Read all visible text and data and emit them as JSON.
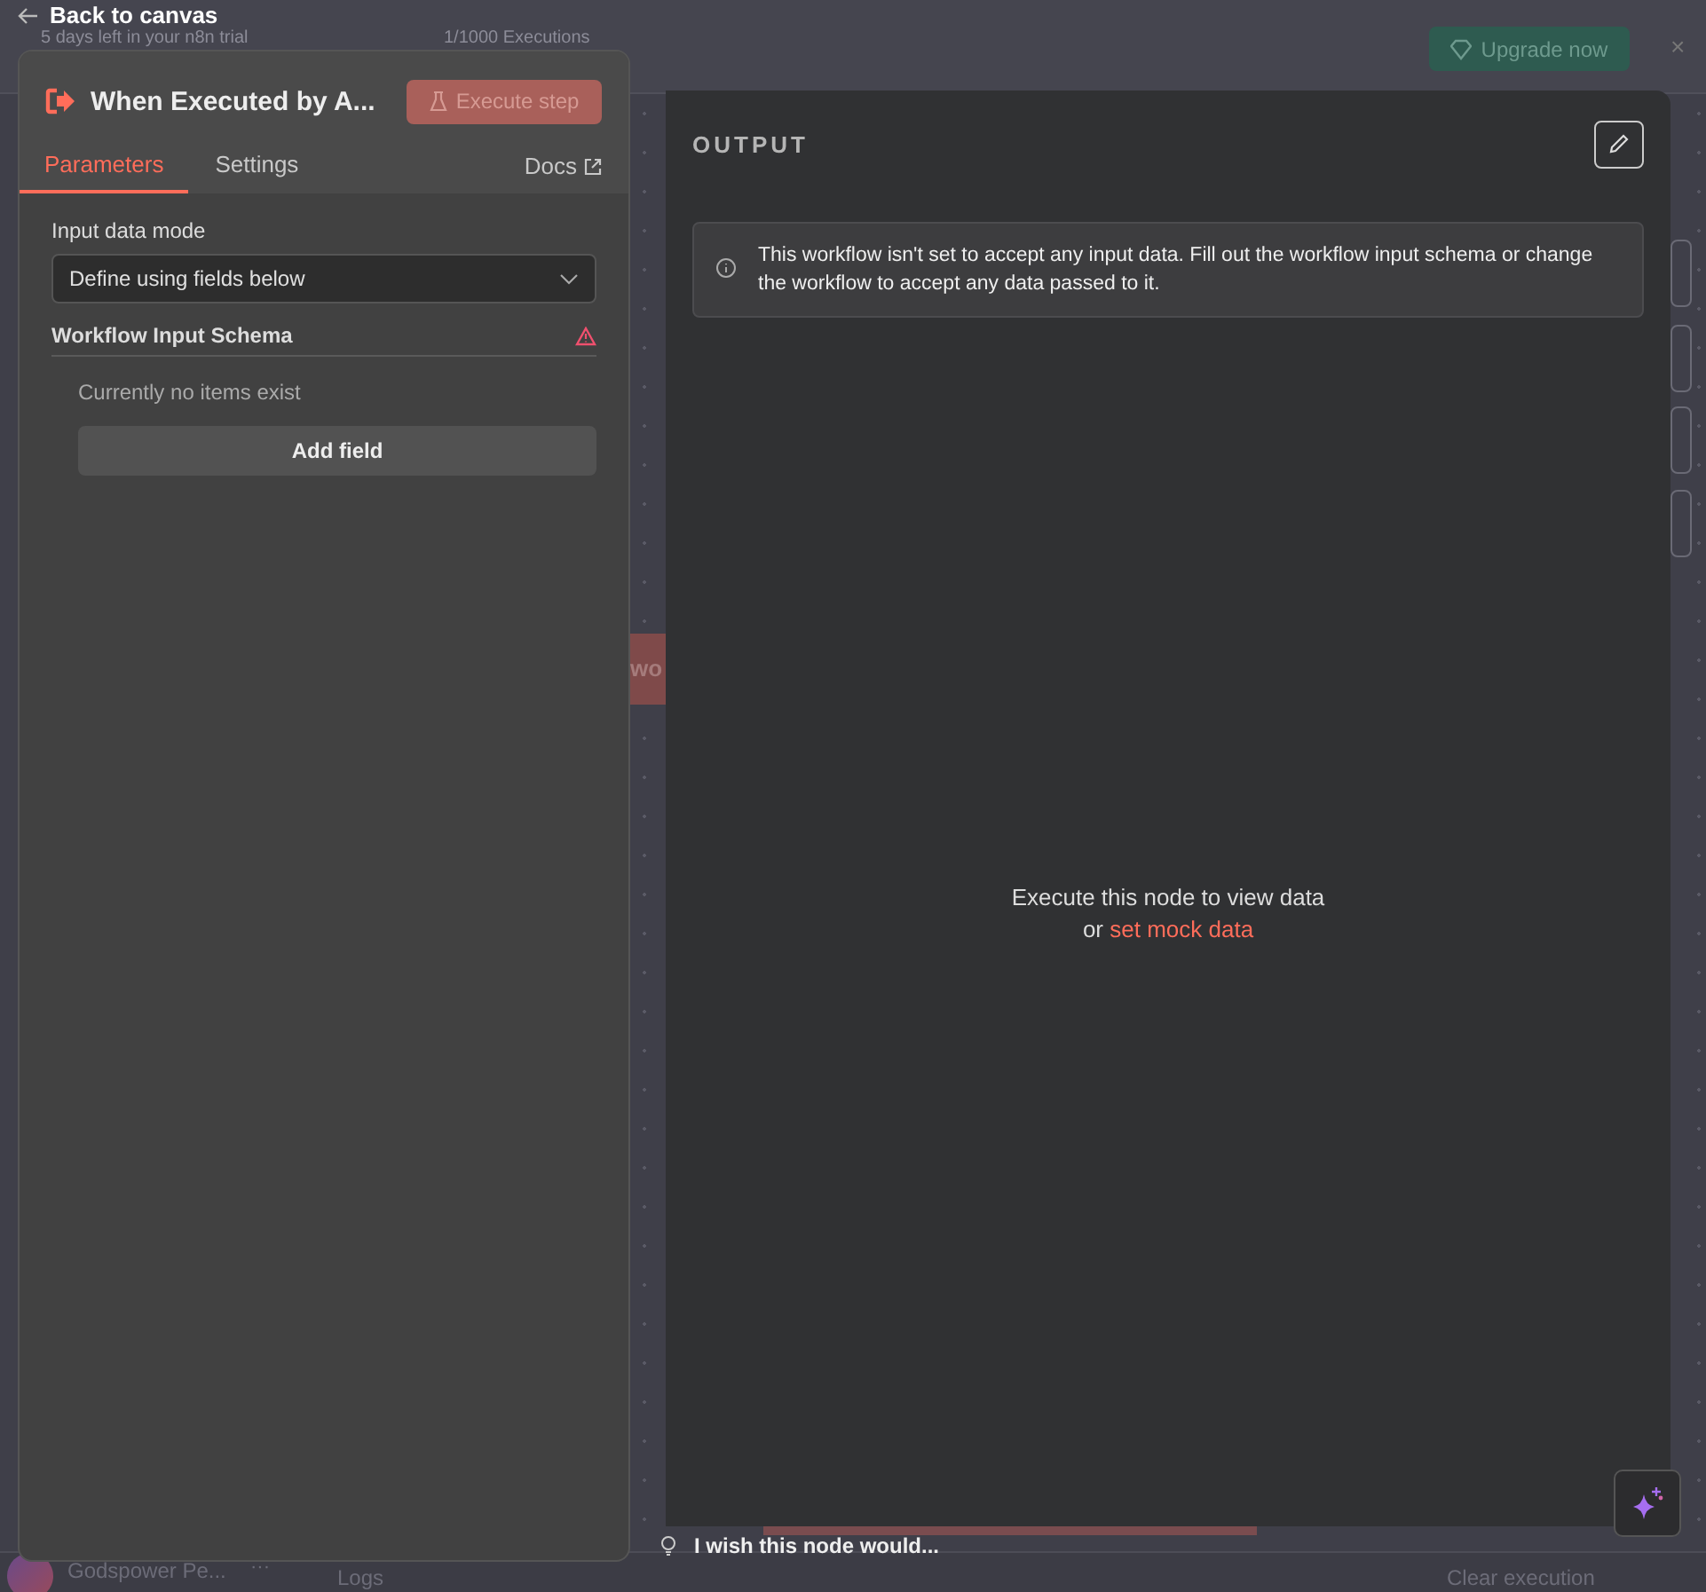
{
  "background": {
    "trial_text": "5 days left in your n8n trial",
    "executions": "1/1000 Executions",
    "upgrade_button": "Upgrade now",
    "close": "×",
    "node_fragment": "wo",
    "user_name": "Godspower Pe...",
    "user_menu": "···",
    "logs_label": "Logs",
    "clear_execution": "Clear execution",
    "wish_text": "I wish this node would..."
  },
  "back_link": "Back to canvas",
  "node_panel": {
    "title": "When Executed by A...",
    "execute_button": {
      "label": "Execute step",
      "disabled": true
    },
    "tabs": [
      {
        "label": "Parameters",
        "selected": true
      },
      {
        "label": "Settings",
        "selected": false
      }
    ],
    "docs_link": "Docs",
    "input_data_mode": {
      "label": "Input data mode",
      "value": "Define using fields below"
    },
    "schema": {
      "title": "Workflow Input Schema",
      "warning": true,
      "empty_text": "Currently no items exist",
      "add_button": "Add field"
    }
  },
  "output_panel": {
    "title": "OUTPUT",
    "notice": "This workflow isn't set to accept any input data. Fill out the workflow input schema or change the workflow to accept any data passed to it.",
    "empty_line": "Execute this node to view data",
    "or_text": "or",
    "mock_link": "set mock data"
  }
}
